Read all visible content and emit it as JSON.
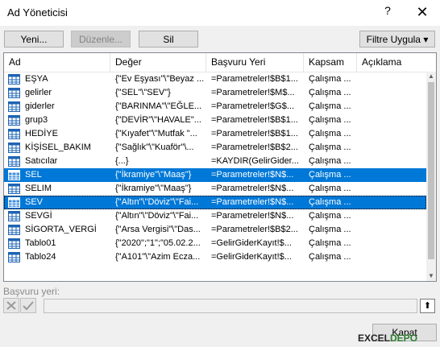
{
  "window": {
    "title": "Ad Yöneticisi",
    "help_glyph": "?",
    "close_glyph": "✕"
  },
  "toolbar": {
    "new_label": "Yeni...",
    "edit_label": "Düzenle...",
    "delete_label": "Sil",
    "filter_label": "Filtre Uygula",
    "filter_arrow": "▾"
  },
  "columns": [
    "Ad",
    "Değer",
    "Başvuru Yeri",
    "Kapsam",
    "Açıklama"
  ],
  "rows": [
    {
      "name": "EŞYA",
      "value": "{\"Ev Eşyası\"\\\"Beyaz ...",
      "ref": "=Parametreler!$B$1...",
      "scope": "Çalışma ...",
      "icon": "table-icon",
      "selected": false
    },
    {
      "name": "gelirler",
      "value": "{\"SEL\"\\\"SEV\"}",
      "ref": "=Parametreler!$M$...",
      "scope": "Çalışma ...",
      "icon": "table-icon",
      "selected": false
    },
    {
      "name": "giderler",
      "value": "{\"BARINMA\"\\\"EĞLE...",
      "ref": "=Parametreler!$G$...",
      "scope": "Çalışma ...",
      "icon": "table-icon",
      "selected": false
    },
    {
      "name": "grup3",
      "value": "{\"DEVİR\"\\\"HAVALE\"...",
      "ref": "=Parametreler!$B$1...",
      "scope": "Çalışma ...",
      "icon": "table-icon",
      "selected": false
    },
    {
      "name": "HEDİYE",
      "value": "{\"Kıyafet\"\\\"Mutfak \"...",
      "ref": "=Parametreler!$B$1...",
      "scope": "Çalışma ...",
      "icon": "table-icon",
      "selected": false
    },
    {
      "name": "KİŞİSEL_BAKIM",
      "value": "{\"Sağlık\"\\\"Kuaför\"\\...",
      "ref": "=Parametreler!$B$2...",
      "scope": "Çalışma ...",
      "icon": "table-icon",
      "selected": false
    },
    {
      "name": "Satıcılar",
      "value": "{...}",
      "ref": "=KAYDIR(GelirGider...",
      "scope": "Çalışma ...",
      "icon": "range-icon",
      "selected": false
    },
    {
      "name": "SEL",
      "value": "{\"İkramiye\"\\\"Maaş\"}",
      "ref": "=Parametreler!$N$...",
      "scope": "Çalışma ...",
      "icon": "table-icon",
      "selected": true
    },
    {
      "name": "SELIM",
      "value": "{\"İkramiye\"\\\"Maaş\"}",
      "ref": "=Parametreler!$N$...",
      "scope": "Çalışma ...",
      "icon": "table-icon",
      "selected": false
    },
    {
      "name": "SEV",
      "value": "{\"Altın\"\\\"Döviz\"\\\"Fai...",
      "ref": "=Parametreler!$N$...",
      "scope": "Çalışma ...",
      "icon": "table-icon",
      "selected": true
    },
    {
      "name": "SEVGİ",
      "value": "{\"Altın\"\\\"Döviz\"\\\"Fai...",
      "ref": "=Parametreler!$N$...",
      "scope": "Çalışma ...",
      "icon": "table-icon",
      "selected": false
    },
    {
      "name": "SİGORTA_VERGİ",
      "value": "{\"Arsa Vergisi\"\\\"Das...",
      "ref": "=Parametreler!$B$2...",
      "scope": "Çalışma ...",
      "icon": "table-icon",
      "selected": false
    },
    {
      "name": "Tablo01",
      "value": "{\"2020\";\"1\";\"05.02.2...",
      "ref": "=GelirGiderKayıt!$...",
      "scope": "Çalışma ...",
      "icon": "table-icon",
      "selected": false
    },
    {
      "name": "Tablo24",
      "value": "{\"A101\"\\\"Azim Ecza...",
      "ref": "=GelirGiderKayıt!$...",
      "scope": "Çalışma ...",
      "icon": "table-icon",
      "selected": false
    }
  ],
  "reference": {
    "label": "Başvuru yeri:",
    "value": "",
    "cancel_glyph": "✕",
    "confirm_glyph": "✓",
    "collapse_glyph": "⬆"
  },
  "footer": {
    "close_label": "Kapat"
  },
  "watermark": {
    "prefix": "EXCEL",
    "suffix": "DEPO"
  },
  "colors": {
    "selection": "#0078d7",
    "background": "#f0f0f0"
  }
}
